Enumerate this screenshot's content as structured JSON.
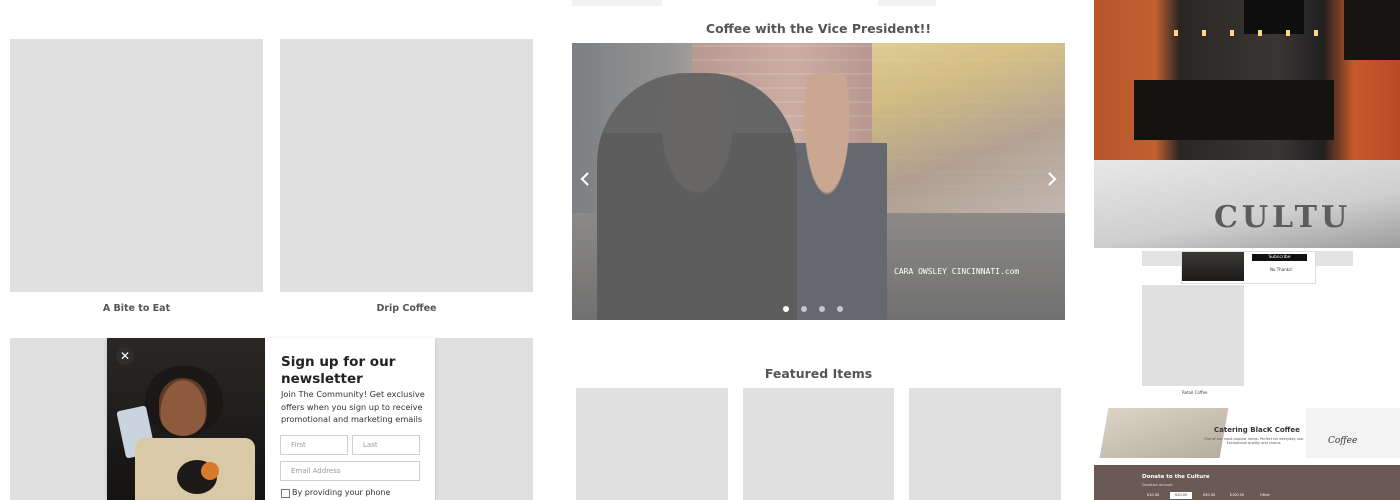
{
  "products_left": [
    {
      "caption": "A Bite to Eat"
    },
    {
      "caption": "Drip Coffee"
    }
  ],
  "carousel": {
    "title": "Coffee with the Vice President!!",
    "watermark": "CARA OWSLEY CINCINNATI.com",
    "prev_icon": "chevron-left-icon",
    "next_icon": "chevron-right-icon",
    "slides": 4,
    "active_slide": 1
  },
  "featured": {
    "title": "Featured Items",
    "count": 3
  },
  "newsletter": {
    "close_icon": "close-icon",
    "close_glyph": "✕",
    "title": "Sign up for our newsletter",
    "text": "Join The Community! Get exclusive offers when you sign up to receive promotional and marketing emails",
    "first_placeholder": "First",
    "last_placeholder": "Last",
    "email_placeholder": "Email Address",
    "consent_label": "By providing your phone"
  },
  "right_column": {
    "subscribe_label": "Subscribe",
    "no_thanks": "No Thanks!",
    "retail_caption": "Retail Coffee",
    "catering_title": "Catering BlacK Coffee",
    "catering_desc": "One of our most popular items. Perfect for everyday use. Exceptional quality and choice.",
    "catering_logo_text": "Coffee",
    "donate_title": "Donate to the Culture",
    "donate_sub": "Donation amount",
    "donate_amounts": [
      "$10.00",
      "$20.00",
      "$50.00",
      "$100.00",
      "Other"
    ],
    "donate_selected": 1,
    "photo_text": "CULTU"
  },
  "colors": {
    "placeholder": "#e0e0e0",
    "heading": "#555555",
    "donate_bg": "#6b5a53"
  }
}
